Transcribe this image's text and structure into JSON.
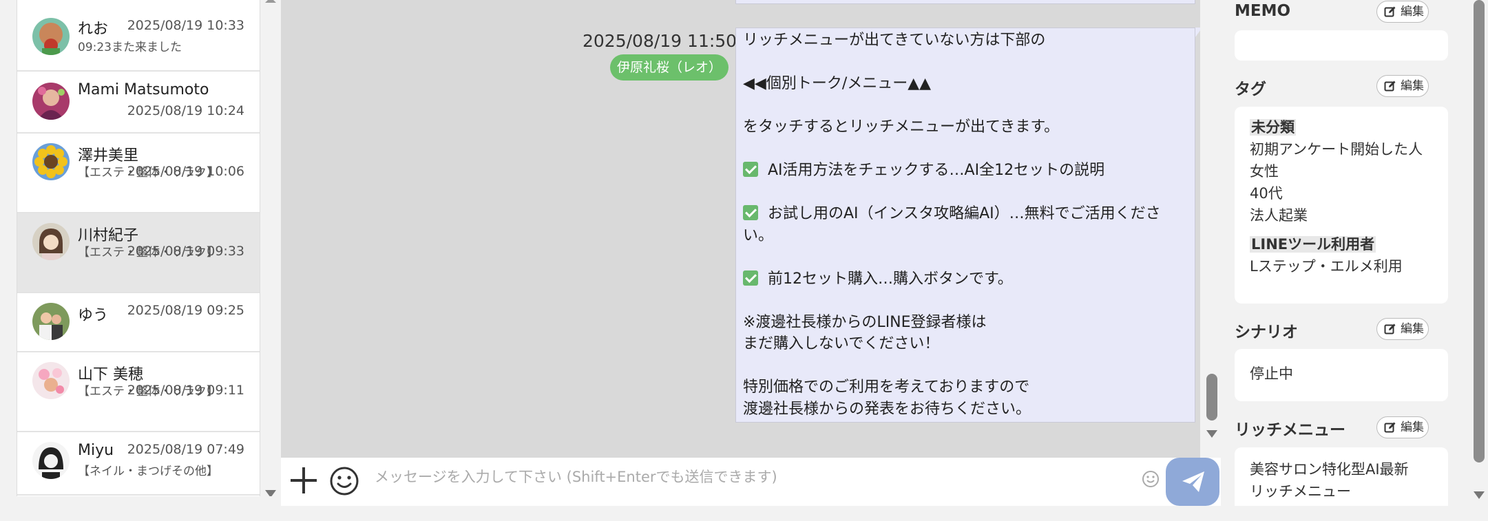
{
  "contacts": [
    {
      "name": "れお",
      "time": "2025/08/19 10:33",
      "preview": "09:23また来ました"
    },
    {
      "name": "Mami Matsumoto",
      "time": "2025/08/19 10:24",
      "preview": ""
    },
    {
      "name": "澤井美里",
      "time": "2025/08/19 10:06",
      "preview": "【エステ・整体・リラク】"
    },
    {
      "name": "川村紀子",
      "time": "2025/08/19 09:33",
      "preview": "【エステ・整体・リラク】",
      "selected": true
    },
    {
      "name": "ゆう",
      "time": "2025/08/19 09:25",
      "preview": ""
    },
    {
      "name": "山下 美穂",
      "time": "2025/08/19 09:11",
      "preview": "【エステ・整体・リラク】"
    },
    {
      "name": "Miyu",
      "time": "2025/08/19 07:49",
      "preview": "【ネイル・まつげその他】"
    }
  ],
  "chat": {
    "message_time": "2025/08/19 11:50",
    "sender_tag": "伊原礼桜（レオ）",
    "message_lines": [
      "リッチメニューが出てきていない方は下部の",
      "",
      "◀◀個別トーク/メニュー▲▲",
      "",
      "をタッチするとリッチメニューが出てきます。",
      "",
      "AI活用方法をチェックする…AI全12セットの説明",
      "",
      "お試し用のAI（インスタ攻略編AI）…無料でご活用ください。",
      "",
      "前12セット購入…購入ボタンです。",
      "",
      "※渡邊社長様からのLINE登録者様は",
      "まだ購入しないでください！",
      "",
      "特別価格でのご利用を考えておりますので",
      "渡邊社長様からの発表をお待ちください。"
    ]
  },
  "input_bar": {
    "placeholder": "メッセージを入力して下さい (Shift+Enterでも送信できます)",
    "value": ""
  },
  "right_panel": {
    "edit_label": "編集",
    "memo": {
      "title": "MEMO",
      "content": ""
    },
    "tags": {
      "title": "タグ",
      "group1_header": "未分類",
      "group1_items": [
        "初期アンケート開始した人",
        "女性",
        "40代",
        "法人起業"
      ],
      "group2_header": "LINEツール利用者",
      "group2_items": [
        "Lステップ・エルメ利用"
      ]
    },
    "scenario": {
      "title": "シナリオ",
      "content": "停止中"
    },
    "rich_menu": {
      "title": "リッチメニュー",
      "content_lines": [
        "美容サロン特化型AI最新",
        "リッチメニュー"
      ]
    }
  },
  "colors": {
    "accent_green": "#6cc06b",
    "bubble_bg": "#e8e9f9",
    "send_button": "#8fa9d8",
    "selected_row": "#e6e6e6"
  }
}
